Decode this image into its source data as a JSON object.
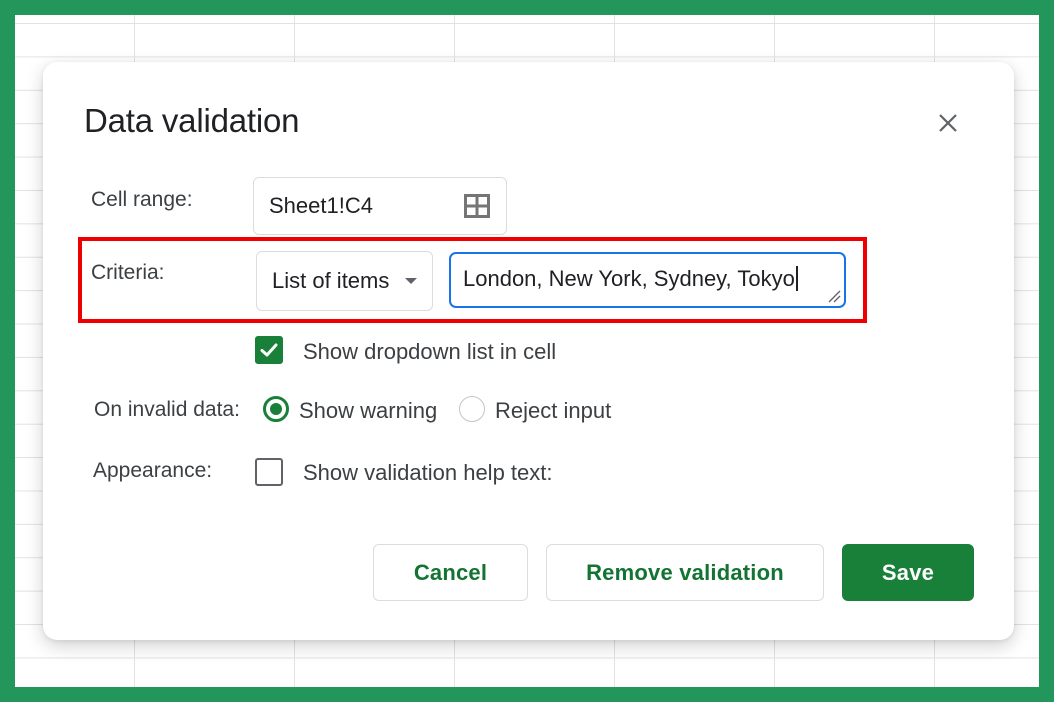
{
  "dialog": {
    "title": "Data validation",
    "close_icon": "close-icon"
  },
  "cell_range": {
    "label": "Cell range:",
    "value": "Sheet1!C4",
    "icon": "select-range-grid-icon"
  },
  "criteria": {
    "label": "Criteria:",
    "type_selected": "List of items",
    "items_value": "London, New York, Sydney, Tokyo",
    "highlight_color": "#ee0000"
  },
  "show_dropdown": {
    "label": "Show dropdown list in cell",
    "checked": true
  },
  "on_invalid": {
    "label": "On invalid data:",
    "options": [
      {
        "label": "Show warning",
        "selected": true
      },
      {
        "label": "Reject input",
        "selected": false
      }
    ]
  },
  "appearance": {
    "label": "Appearance:",
    "help_text_label": "Show validation help text:",
    "checked": false
  },
  "buttons": {
    "cancel": "Cancel",
    "remove": "Remove validation",
    "save": "Save"
  },
  "colors": {
    "frame": "#23975b",
    "accent_green": "#188038",
    "focus_blue": "#1a73e8"
  }
}
